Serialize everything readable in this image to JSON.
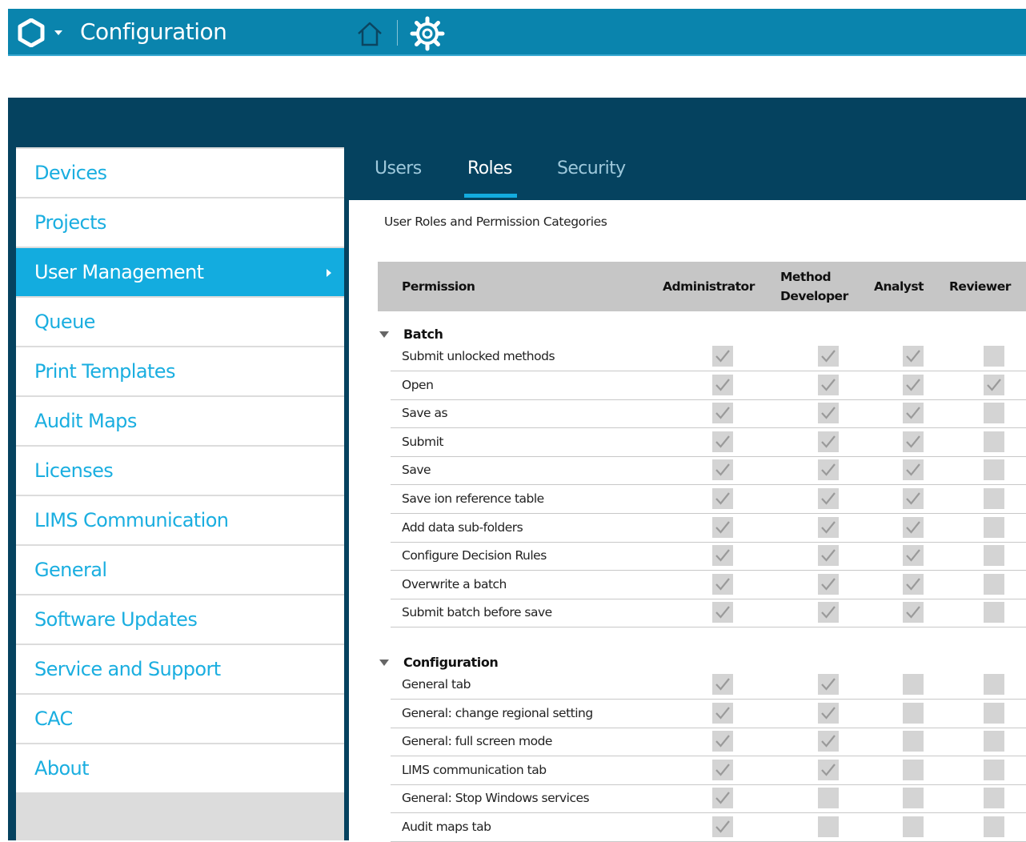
{
  "app": {
    "title": "Configuration"
  },
  "colors": {
    "topbar": "#0a84ad",
    "dark": "#05425f",
    "accent": "#13acdf",
    "link": "#1aaee0"
  },
  "icons": {
    "logo": "hexagon-logo-icon",
    "home": "home-icon",
    "settings": "gear-icon"
  },
  "sidebar": {
    "items": [
      {
        "label": "Devices",
        "active": false
      },
      {
        "label": "Projects",
        "active": false
      },
      {
        "label": "User Management",
        "active": true
      },
      {
        "label": "Queue",
        "active": false
      },
      {
        "label": "Print Templates",
        "active": false
      },
      {
        "label": "Audit Maps",
        "active": false
      },
      {
        "label": "Licenses",
        "active": false
      },
      {
        "label": "LIMS Communication",
        "active": false
      },
      {
        "label": "General",
        "active": false
      },
      {
        "label": "Software Updates",
        "active": false
      },
      {
        "label": "Service and Support",
        "active": false
      },
      {
        "label": "CAC",
        "active": false
      },
      {
        "label": "About",
        "active": false
      }
    ]
  },
  "tabs": [
    {
      "label": "Users",
      "active": false
    },
    {
      "label": "Roles",
      "active": true
    },
    {
      "label": "Security",
      "active": false
    }
  ],
  "main": {
    "subtitle": "User Roles and Permission Categories",
    "columns": {
      "permission": "Permission",
      "administrator": "Administrator",
      "method_developer_line1": "Method",
      "method_developer_line2": "Developer",
      "analyst": "Analyst",
      "reviewer": "Reviewer"
    },
    "groups": [
      {
        "name": "Batch",
        "rows": [
          {
            "label": "Submit unlocked methods",
            "checks": [
              true,
              true,
              true,
              false
            ]
          },
          {
            "label": "Open",
            "checks": [
              true,
              true,
              true,
              true
            ]
          },
          {
            "label": "Save as",
            "checks": [
              true,
              true,
              true,
              false
            ]
          },
          {
            "label": "Submit",
            "checks": [
              true,
              true,
              true,
              false
            ]
          },
          {
            "label": "Save",
            "checks": [
              true,
              true,
              true,
              false
            ]
          },
          {
            "label": "Save ion reference table",
            "checks": [
              true,
              true,
              true,
              false
            ]
          },
          {
            "label": "Add data sub-folders",
            "checks": [
              true,
              true,
              true,
              false
            ]
          },
          {
            "label": "Configure Decision Rules",
            "checks": [
              true,
              true,
              true,
              false
            ]
          },
          {
            "label": "Overwrite a batch",
            "checks": [
              true,
              true,
              true,
              false
            ]
          },
          {
            "label": "Submit batch before save",
            "checks": [
              true,
              true,
              true,
              false
            ]
          }
        ]
      },
      {
        "name": "Configuration",
        "rows": [
          {
            "label": "General tab",
            "checks": [
              true,
              true,
              false,
              false
            ]
          },
          {
            "label": "General: change regional setting",
            "checks": [
              true,
              true,
              false,
              false
            ]
          },
          {
            "label": "General: full screen mode",
            "checks": [
              true,
              true,
              false,
              false
            ]
          },
          {
            "label": "LIMS communication tab",
            "checks": [
              true,
              true,
              false,
              false
            ]
          },
          {
            "label": "General: Stop Windows services",
            "checks": [
              true,
              false,
              false,
              false
            ]
          },
          {
            "label": "Audit maps tab",
            "checks": [
              true,
              false,
              false,
              false
            ]
          }
        ]
      }
    ]
  }
}
